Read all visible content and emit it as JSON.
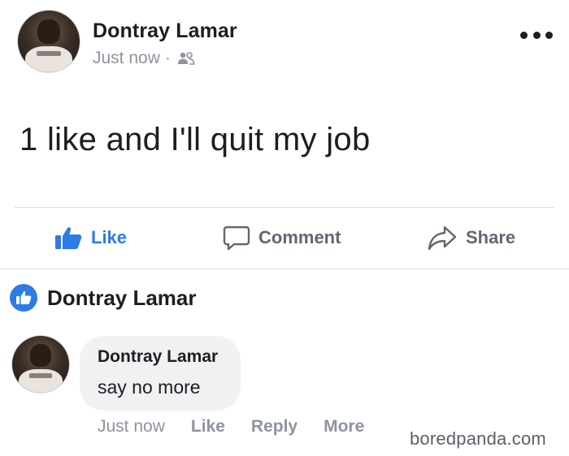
{
  "post": {
    "author": "Dontray Lamar",
    "timestamp": "Just now",
    "separator": "·",
    "audience_icon": "friends-icon",
    "more_icon": "more-options-icon",
    "text": "1 like and I'll quit my job"
  },
  "actions": {
    "like": "Like",
    "comment": "Comment",
    "share": "Share"
  },
  "reactions": {
    "liker_name": "Dontray Lamar",
    "badge_icon": "like-badge-icon"
  },
  "comment": {
    "author": "Dontray Lamar",
    "text": "say no more",
    "timestamp": "Just now",
    "like": "Like",
    "reply": "Reply",
    "more": "More"
  },
  "watermark": "boredpanda.com",
  "colors": {
    "accent": "#2d7be5",
    "text": "#1c1e21",
    "muted": "#8d949e",
    "bubble": "#f0f1f3"
  }
}
